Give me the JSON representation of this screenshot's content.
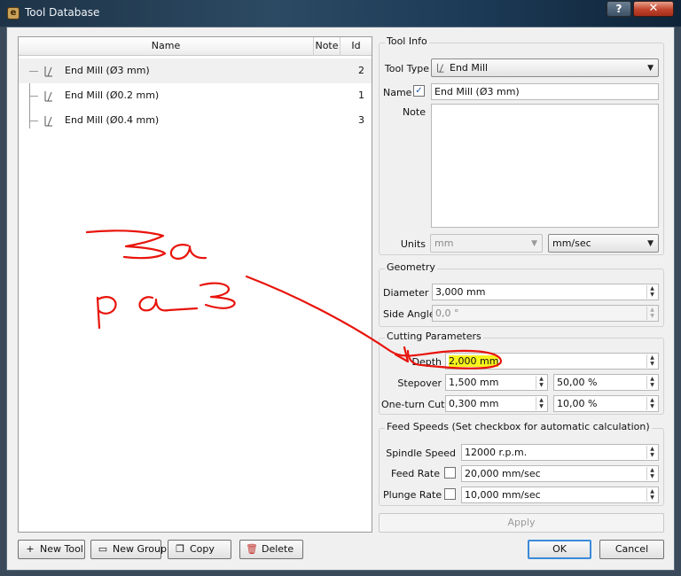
{
  "window": {
    "title": "Tool Database",
    "help_label": "?",
    "close_label": "✕"
  },
  "tree": {
    "columns": [
      "Name",
      "Note",
      "Id"
    ],
    "rows": [
      {
        "name": "End Mill (Ø3 mm)",
        "note": "",
        "id": "2"
      },
      {
        "name": "End Mill (Ø0.2 mm)",
        "note": "",
        "id": "1"
      },
      {
        "name": "End Mill (Ø0.4 mm)",
        "note": "",
        "id": "3"
      }
    ]
  },
  "buttons": {
    "new_tool": "New Tool",
    "new_group": "New Group",
    "copy": "Copy",
    "delete": "Delete",
    "apply": "Apply",
    "ok": "OK",
    "cancel": "Cancel"
  },
  "tool_info": {
    "title": "Tool Info",
    "tool_type_label": "Tool Type",
    "tool_type_value": "End Mill",
    "name_label": "Name",
    "name_checked": true,
    "name_value": "End Mill (Ø3 mm)",
    "note_label": "Note",
    "note_value": "",
    "units_label": "Units",
    "units_value": "mm",
    "speed_units_value": "mm/sec"
  },
  "geometry": {
    "title": "Geometry",
    "diameter_label": "Diameter",
    "diameter_value": "3,000 mm",
    "side_angle_label": "Side Angle",
    "side_angle_value": "0,0 °"
  },
  "cutting": {
    "title": "Cutting Parameters",
    "depth_label": "Depth",
    "depth_value": "2,000 mm",
    "stepover_label": "Stepover",
    "stepover_value": "1,500 mm",
    "stepover_pct": "50,00 %",
    "one_turn_label": "One-turn Cut",
    "one_turn_value": "0,300 mm",
    "one_turn_pct": "10,00 %"
  },
  "feeds": {
    "title": "Feed Speeds (Set checkbox for automatic calculation)",
    "spindle_label": "Spindle Speed",
    "spindle_value": "12000 r.p.m.",
    "feed_label": "Feed Rate",
    "feed_value": "20,000 mm/sec",
    "plunge_label": "Plunge Rate",
    "plunge_value": "10,000 mm/sec"
  },
  "colors": {
    "annotation": "#e8140c",
    "highlight": "#f6f31d"
  }
}
